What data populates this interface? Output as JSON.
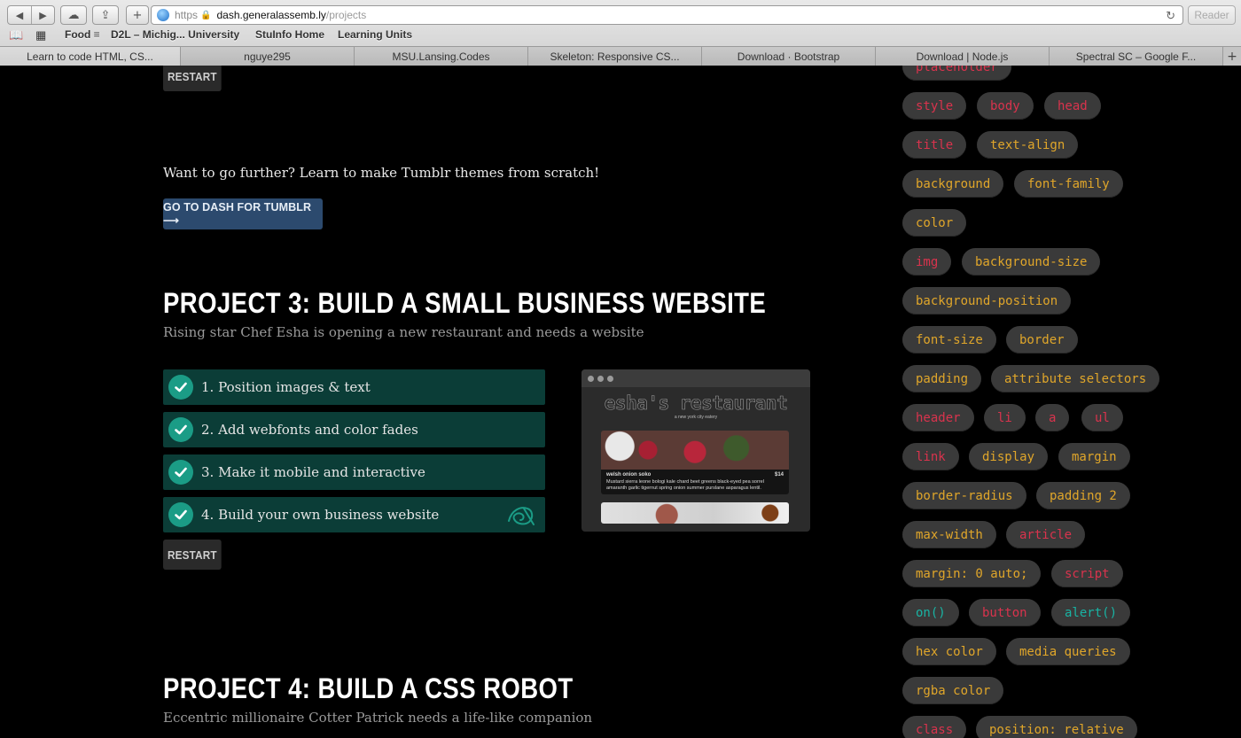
{
  "browser": {
    "url_scheme": "https",
    "url_host": "dash.generalassemb.ly",
    "url_path": "/projects",
    "reader_label": "Reader",
    "bookmarks": [
      "Food ≡",
      "D2L – Michig... University",
      "StuInfo Home",
      "Learning Units"
    ],
    "tabs": [
      {
        "label": "Learn to code HTML, CS..."
      },
      {
        "label": "nguye295"
      },
      {
        "label": "MSU.Lansing.Codes"
      },
      {
        "label": "Skeleton: Responsive CS..."
      },
      {
        "label": "Download · Bootstrap"
      },
      {
        "label": "Download | Node.js"
      },
      {
        "label": "Spectral SC – Google F..."
      }
    ]
  },
  "project2": {
    "restart_label": "RESTART",
    "further_text": "Want to go further? Learn to make Tumblr themes from scratch!",
    "dash_button": "GO TO DASH FOR TUMBLR ⟶"
  },
  "project3": {
    "title": "PROJECT 3: BUILD A SMALL BUSINESS WEBSITE",
    "subtitle": "Rising star Chef Esha is opening a new restaurant and needs a website",
    "steps": [
      {
        "label": "1. Position images & text",
        "completed": true
      },
      {
        "label": "2. Add webfonts and color fades",
        "completed": true
      },
      {
        "label": "3. Make it mobile and interactive",
        "completed": true
      },
      {
        "label": "4. Build your own business website",
        "completed": true
      }
    ],
    "restart_label": "RESTART",
    "preview": {
      "site_title": "esha's restaurant",
      "site_tagline": "a new york city eatery",
      "dish_name": "welsh onion soko",
      "dish_price": "$14",
      "dish_desc": "Mustard sierra leone bologi kale chard beet greens black-eyed pea sorrel amaranth garlic tigernut spring onion summer purslane asparagus lentil."
    }
  },
  "project4": {
    "title": "PROJECT 4: BUILD A CSS ROBOT",
    "subtitle": "Eccentric millionaire Cotter Patrick needs a life-like companion"
  },
  "tags": [
    {
      "label": "placeholder",
      "color": "#d9334d"
    },
    {
      "label": "style",
      "color": "#d9334d"
    },
    {
      "label": "body",
      "color": "#d9334d"
    },
    {
      "label": "head",
      "color": "#d9334d"
    },
    {
      "label": "title",
      "color": "#d9334d"
    },
    {
      "label": "text-align",
      "color": "#e0a62a"
    },
    {
      "label": "background",
      "color": "#e0a62a"
    },
    {
      "label": "font-family",
      "color": "#e0a62a"
    },
    {
      "label": "color",
      "color": "#e0a62a"
    },
    {
      "label": "img",
      "color": "#d9334d"
    },
    {
      "label": "background-size",
      "color": "#e0a62a"
    },
    {
      "label": "background-position",
      "color": "#e0a62a"
    },
    {
      "label": "font-size",
      "color": "#e0a62a"
    },
    {
      "label": "border",
      "color": "#e0a62a"
    },
    {
      "label": "padding",
      "color": "#e0a62a"
    },
    {
      "label": "attribute selectors",
      "color": "#e0a62a"
    },
    {
      "label": "header",
      "color": "#d9334d"
    },
    {
      "label": "li",
      "color": "#d9334d"
    },
    {
      "label": "a",
      "color": "#d9334d"
    },
    {
      "label": "ul",
      "color": "#d9334d"
    },
    {
      "label": "link",
      "color": "#d9334d"
    },
    {
      "label": "display",
      "color": "#e0a62a"
    },
    {
      "label": "margin",
      "color": "#e0a62a"
    },
    {
      "label": "border-radius",
      "color": "#e0a62a"
    },
    {
      "label": "padding 2",
      "color": "#e0a62a"
    },
    {
      "label": "max-width",
      "color": "#e0a62a"
    },
    {
      "label": "article",
      "color": "#d9334d"
    },
    {
      "label": "margin: 0 auto;",
      "color": "#e0a62a"
    },
    {
      "label": "script",
      "color": "#d9334d"
    },
    {
      "label": "on()",
      "color": "#19b3a3"
    },
    {
      "label": "button",
      "color": "#d9334d"
    },
    {
      "label": "alert()",
      "color": "#19b3a3"
    },
    {
      "label": "hex color",
      "color": "#e0a62a"
    },
    {
      "label": "media queries",
      "color": "#e0a62a"
    },
    {
      "label": "rgba color",
      "color": "#e0a62a"
    },
    {
      "label": "class",
      "color": "#d9334d"
    },
    {
      "label": "position: relative",
      "color": "#e0a62a"
    }
  ]
}
